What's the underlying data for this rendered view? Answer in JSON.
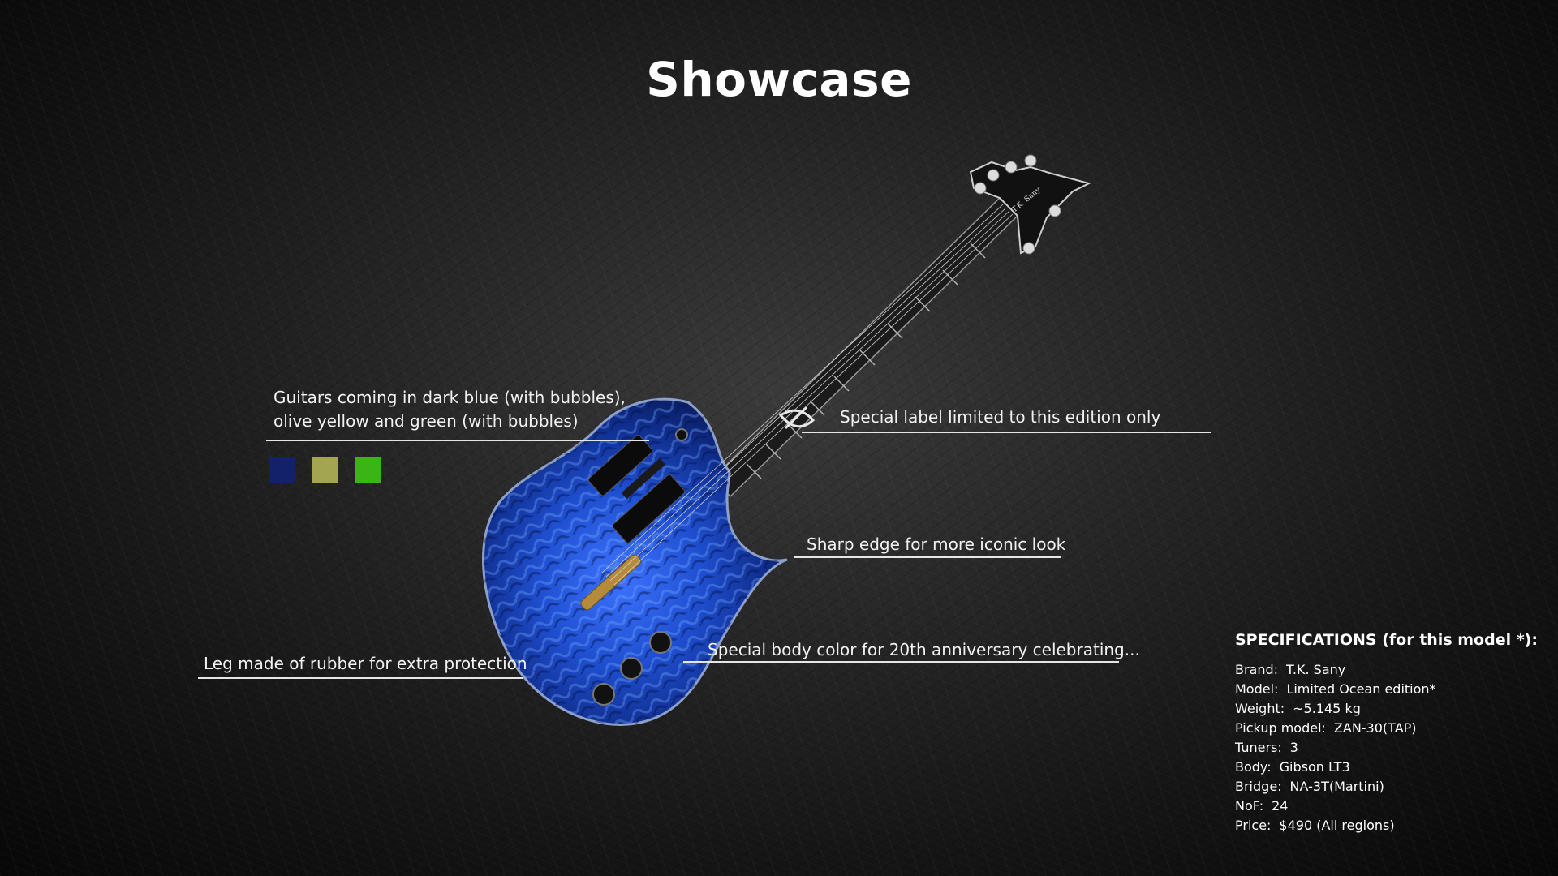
{
  "page": {
    "title": "Showcase"
  },
  "callouts": {
    "colors_line1": "Guitars coming in dark blue (with bubbles),",
    "colors_line2": "olive yellow and green (with bubbles)",
    "label": "Special label limited to this edition only",
    "edge": "Sharp edge for more iconic look",
    "body": "Special body color for 20th anniversary celebrating...",
    "leg": "Leg made of rubber for extra protection"
  },
  "colors": [
    {
      "name": "dark-blue",
      "hex": "#13206a"
    },
    {
      "name": "olive-yellow",
      "hex": "#a3a550"
    },
    {
      "name": "green",
      "hex": "#3ab515"
    }
  ],
  "guitar": {
    "headstock_text": "T.K. Sany",
    "body_color": "#1f4fd0"
  },
  "specs": {
    "title": "SPECIFICATIONS (for this model *):",
    "rows": [
      {
        "label": "Brand:",
        "value": "T.K. Sany"
      },
      {
        "label": "Model:",
        "value": "Limited Ocean edition*"
      },
      {
        "label": "Weight:",
        "value": "~5.145 kg"
      },
      {
        "label": "Pickup model:",
        "value": "ZAN-30(TAP)"
      },
      {
        "label": "Tuners:",
        "value": "3"
      },
      {
        "label": "Body:",
        "value": "Gibson LT3"
      },
      {
        "label": "Bridge:",
        "value": "NA-3T(Martini)"
      },
      {
        "label": "NoF:",
        "value": "24"
      },
      {
        "label": "Price:",
        "value": "$490 (All regions)"
      }
    ]
  }
}
